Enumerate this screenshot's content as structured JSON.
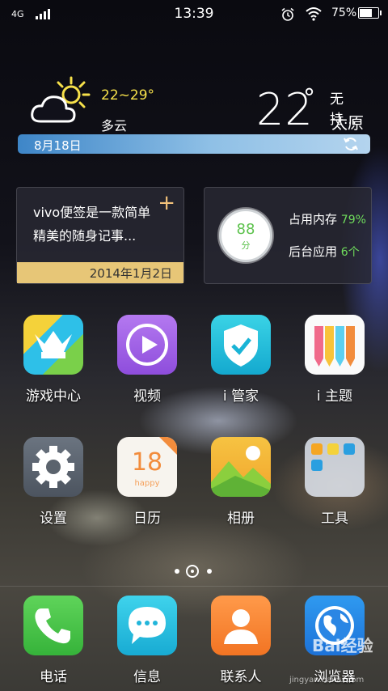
{
  "status_bar": {
    "network": "4G",
    "time": "13:39",
    "battery_text": "75%",
    "battery_level": 0.75
  },
  "weather": {
    "temp_range": "22~29°",
    "condition": "多云",
    "current_temp": "22",
    "degree_symbol": "°",
    "status_text": "无持...",
    "city": "太原",
    "date": "8月18日"
  },
  "note_widget": {
    "text": "vivo便签是一款简单精美的随身记事...",
    "date": "2014年1月2日"
  },
  "memory_widget": {
    "score": "88",
    "score_unit": "分",
    "memory_label": "占用内存",
    "memory_value": "79%",
    "bg_apps_label": "后台应用",
    "bg_apps_value": "6个"
  },
  "apps_row1": [
    {
      "label": "游戏中心"
    },
    {
      "label": "视频"
    },
    {
      "label": "i 管家"
    },
    {
      "label": "i 主题"
    }
  ],
  "apps_row2": [
    {
      "label": "设置"
    },
    {
      "label": "日历",
      "day": "18",
      "sub": "happy"
    },
    {
      "label": "相册"
    },
    {
      "label": "工具"
    }
  ],
  "dock": [
    {
      "label": "电话"
    },
    {
      "label": "信息"
    },
    {
      "label": "联系人"
    },
    {
      "label": "浏览器"
    }
  ],
  "watermark": {
    "brand": "Bai经验",
    "url": "jingyan.baidu.com"
  },
  "colors": {
    "accent_yellow": "#f6e04a",
    "memory_green": "#6fdc5c"
  }
}
